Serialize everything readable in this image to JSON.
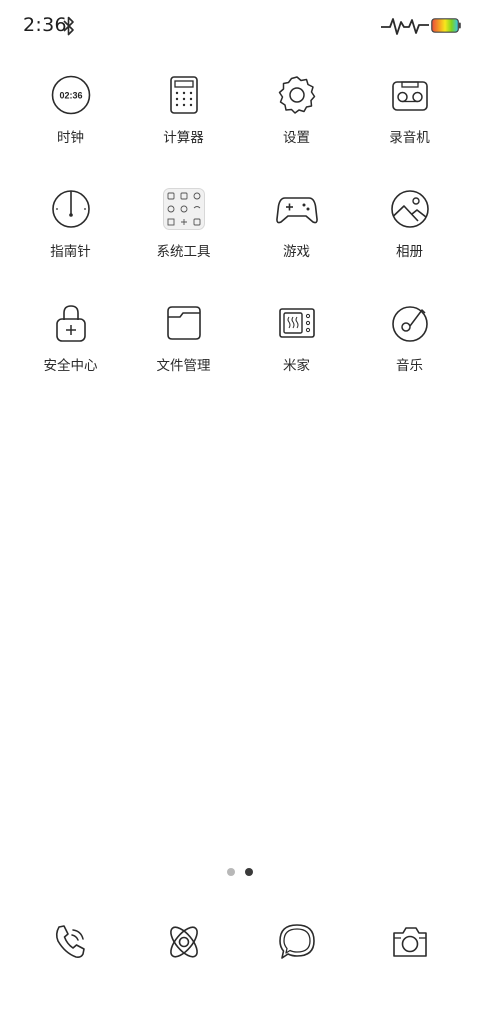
{
  "status_bar": {
    "time": "2:36",
    "icons": [
      "bluetooth-icon",
      "activity-pulse-icon",
      "battery-icon"
    ],
    "battery_gradient": [
      "#e94b3c",
      "#f6a623",
      "#f8e71c",
      "#7ed321",
      "#36c5f0"
    ]
  },
  "apps": [
    {
      "label": "时钟",
      "icon": "clock-icon",
      "clock_text": "02:36"
    },
    {
      "label": "计算器",
      "icon": "calculator-icon"
    },
    {
      "label": "设置",
      "icon": "settings-gear-icon"
    },
    {
      "label": "录音机",
      "icon": "recorder-icon"
    },
    {
      "label": "指南针",
      "icon": "compass-icon"
    },
    {
      "label": "系统工具",
      "icon": "system-tools-folder-icon"
    },
    {
      "label": "游戏",
      "icon": "gamepad-icon"
    },
    {
      "label": "相册",
      "icon": "gallery-icon"
    },
    {
      "label": "安全中心",
      "icon": "security-lock-icon"
    },
    {
      "label": "文件管理",
      "icon": "folder-icon"
    },
    {
      "label": "米家",
      "icon": "mijia-device-icon"
    },
    {
      "label": "音乐",
      "icon": "music-disc-icon"
    }
  ],
  "page_indicator": {
    "total": 2,
    "current": 2
  },
  "dock": [
    {
      "icon": "phone-icon"
    },
    {
      "icon": "browser-orbit-icon"
    },
    {
      "icon": "messages-bubble-icon"
    },
    {
      "icon": "camera-icon"
    }
  ],
  "colors": {
    "stroke": "#2b2b2b",
    "dot_inactive": "#b8b8b8",
    "dot_active": "#3a3a3a",
    "background": "#ffffff"
  }
}
